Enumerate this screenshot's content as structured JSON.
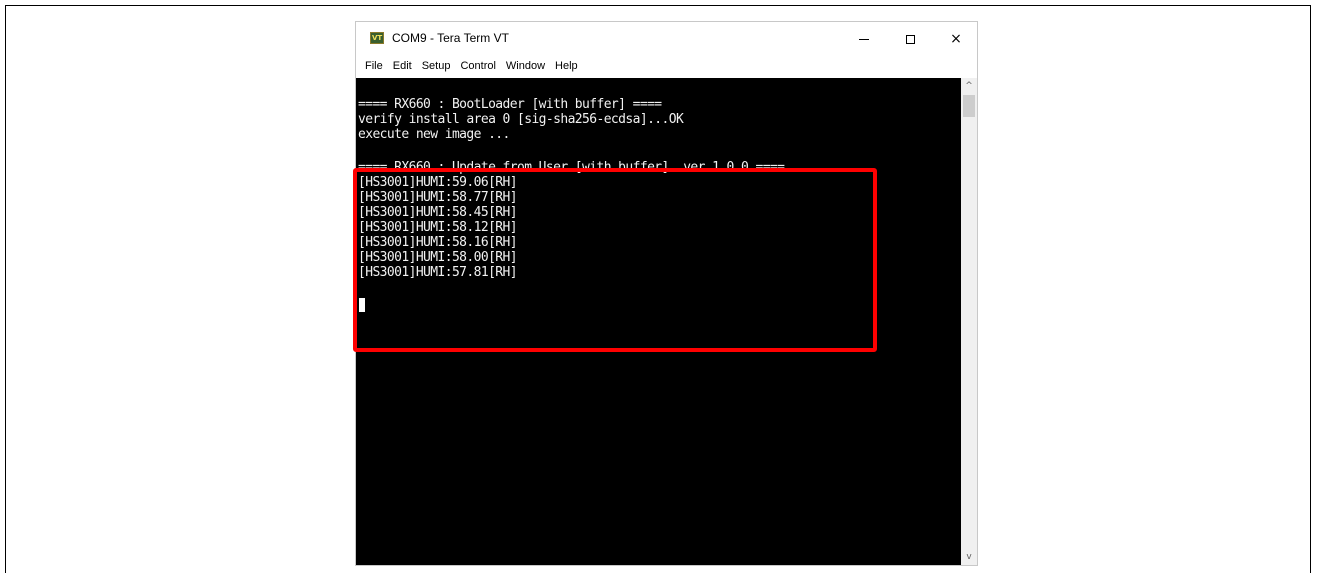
{
  "window": {
    "title": "COM9 - Tera Term VT",
    "icon_label": "VT",
    "icon_name": "tera-term-icon"
  },
  "controls": {
    "minimize": "minimize-icon",
    "maximize": "maximize-icon",
    "close": "×"
  },
  "menu": {
    "items": [
      "File",
      "Edit",
      "Setup",
      "Control",
      "Window",
      "Help"
    ]
  },
  "terminal": {
    "lines": [
      "==== RX660 : BootLoader [with buffer] ====",
      "verify install area 0 [sig-sha256-ecdsa]...OK",
      "execute new image ...",
      "",
      "==== RX660 : Update from User [with buffer]  ver 1.0.0 ====",
      "[HS3001]HUMI:59.06[RH]",
      "[HS3001]HUMI:58.77[RH]",
      "[HS3001]HUMI:58.45[RH]",
      "[HS3001]HUMI:58.12[RH]",
      "[HS3001]HUMI:58.16[RH]",
      "[HS3001]HUMI:58.00[RH]",
      "[HS3001]HUMI:57.81[RH]"
    ],
    "background": "#000000",
    "text_color": "#f2f2f2"
  },
  "scrollbar": {
    "up_arrow": "^",
    "down_arrow": "v"
  },
  "colors": {
    "highlight": "#ff0000"
  }
}
